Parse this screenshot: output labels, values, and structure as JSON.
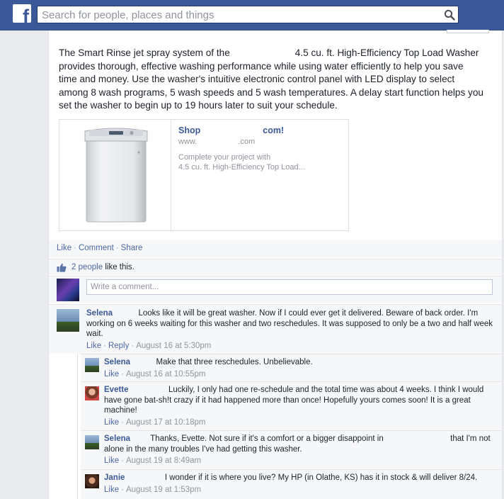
{
  "search": {
    "placeholder": "Search for people, places and things"
  },
  "post": {
    "text_part1": "The Smart Rinse jet spray system of the",
    "text_part2": "4.5 cu. ft. High-Efficiency Top Load Washer provides thorough, effective washing performance while using water efficiently to help you save time and money. Use the washer's intuitive electronic control panel with LED display to select among 8 wash programs, 5 wash speeds and 5 wash temperatures. A delay start function helps you set the washer to begin up to 19 hours later to suit your schedule."
  },
  "link_preview": {
    "title_part1": "Shop",
    "title_part2": "com!",
    "domain_part1": "www.",
    "domain_part2": ".com",
    "desc_part1": "Complete your project with",
    "desc_part2": "4.5 cu. ft. High-Efficiency Top Load..."
  },
  "actions": {
    "like": "Like",
    "comment": "Comment",
    "share": "Share",
    "separator": "·"
  },
  "likes": {
    "text_link": "2 people",
    "text_rest": "like this."
  },
  "compose": {
    "placeholder": "Write a comment..."
  },
  "comments": [
    {
      "name": "Selena",
      "text": "Looks like it will be great washer. Now if I could ever get it delivered. Beware of back order. I'm working on 6 weeks waiting for this washer and two reschedules. It was supposed to only be a two and half week wait.",
      "like": "Like",
      "reply": "Reply",
      "time": "August 16 at 5:30pm"
    },
    {
      "name": "Selena",
      "text": "Make that three reschedules. Unbelievable.",
      "like": "Like",
      "time": "August 16 at 10:55pm"
    },
    {
      "name": "Evette",
      "text": "Luckily, I only had one re-schedule and the total time was about 4 weeks. I think I would have gone bat-sh!t crazy if it had happened more than once! Hopefully yours comes soon! It is a great machine!",
      "like": "Like",
      "time": "August 17 at 10:18pm"
    },
    {
      "name": "Selena",
      "text_part1": "Thanks, Evette. Not sure if it's a comfort or a bigger disappoint in",
      "text_part2": "that I'm not alone in the many troubles I've had getting this washer.",
      "like": "Like",
      "time": "August 19 at 8:49am"
    },
    {
      "name": "Janie",
      "text": "I wonder if it is where you live? My HP (in Olathe, KS) has it in stock & will deliver 8/24.",
      "like": "Like",
      "time": "August 19 at 1:53pm"
    }
  ],
  "colors": {
    "brand": "#3b5998",
    "link": "#4b67a1",
    "meta": "#90949c",
    "panel": "#f6f7f9"
  }
}
